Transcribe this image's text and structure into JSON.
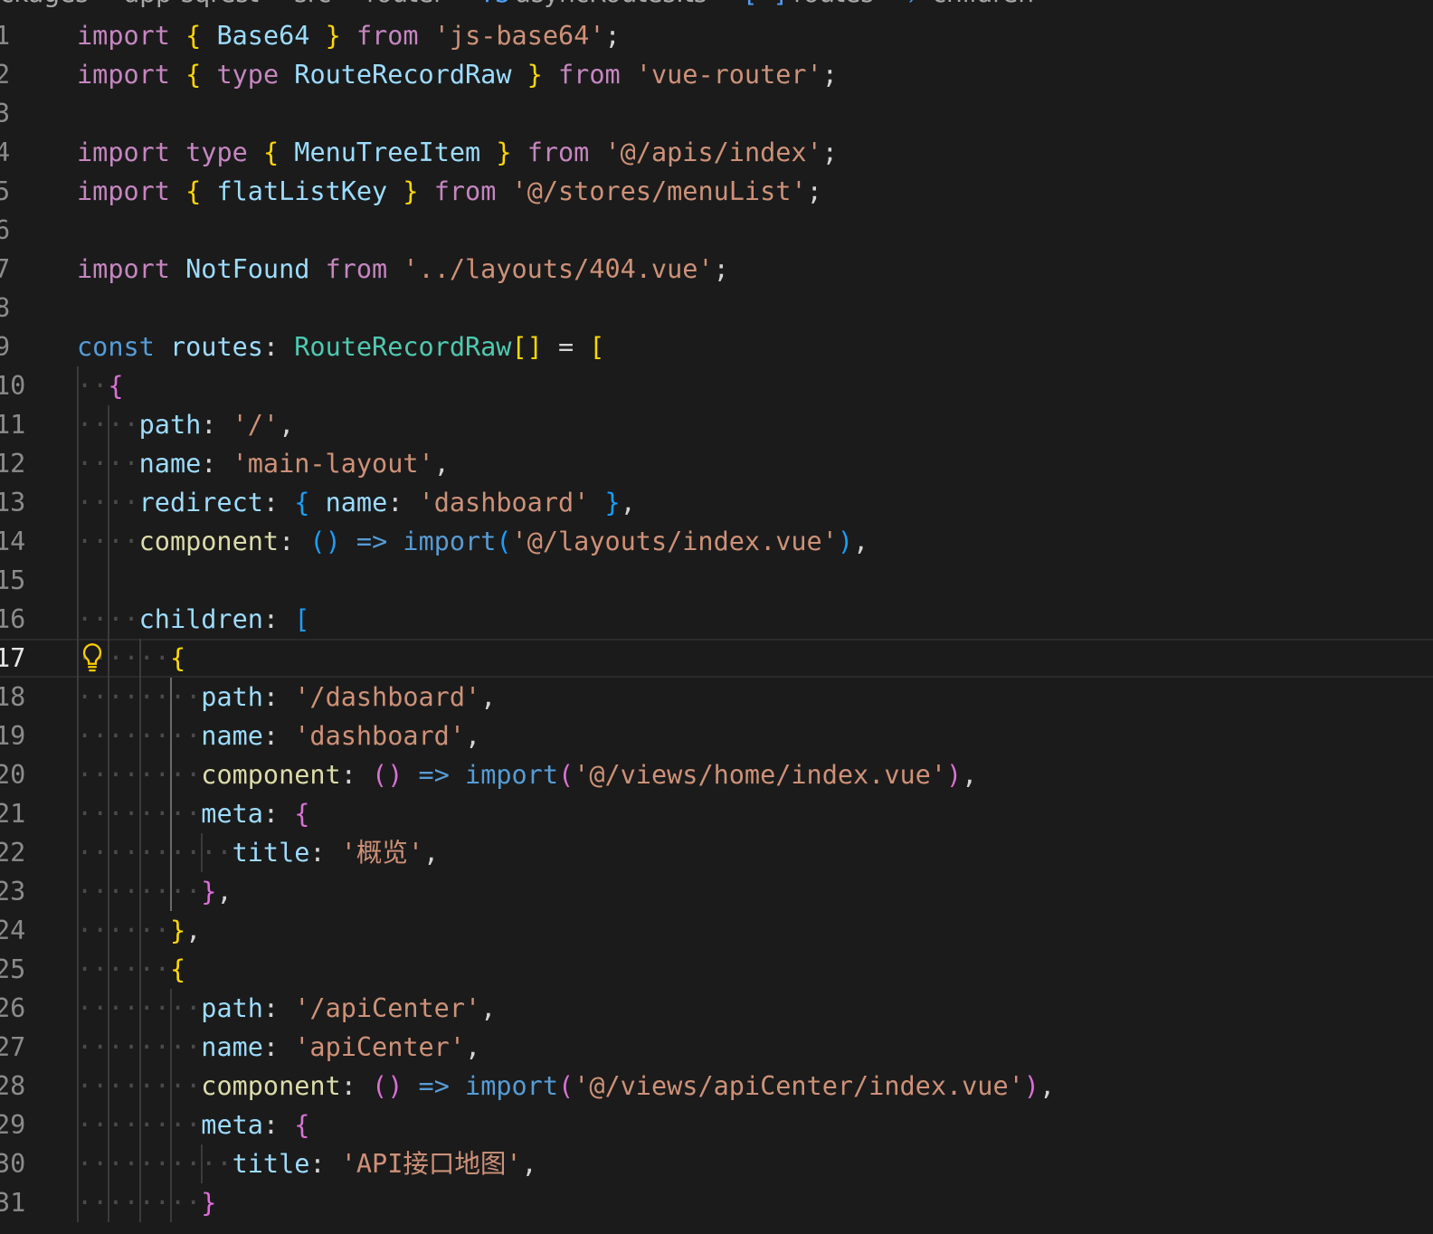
{
  "breadcrumb": {
    "items": [
      "ckages",
      "app-sqrest",
      "src",
      "router",
      "asyncRoutes.ts",
      "routes",
      "children"
    ],
    "icons": [
      "ts-file-icon",
      "array-icon",
      "property-icon"
    ]
  },
  "editor": {
    "current_line": 17,
    "lines": [
      {
        "num": "1",
        "tokens": [
          [
            "kw",
            "import"
          ],
          [
            "p",
            " "
          ],
          [
            "b1",
            "{"
          ],
          [
            "p",
            " "
          ],
          [
            "var",
            "Base64"
          ],
          [
            "p",
            " "
          ],
          [
            "b1",
            "}"
          ],
          [
            "p",
            " "
          ],
          [
            "kw",
            "from"
          ],
          [
            "p",
            " "
          ],
          [
            "str",
            "'js-base64'"
          ],
          [
            "p",
            ";"
          ]
        ]
      },
      {
        "num": "2",
        "tokens": [
          [
            "kw",
            "import"
          ],
          [
            "p",
            " "
          ],
          [
            "b1",
            "{"
          ],
          [
            "p",
            " "
          ],
          [
            "kw",
            "type"
          ],
          [
            "p",
            " "
          ],
          [
            "var",
            "RouteRecordRaw"
          ],
          [
            "p",
            " "
          ],
          [
            "b1",
            "}"
          ],
          [
            "p",
            " "
          ],
          [
            "kw",
            "from"
          ],
          [
            "p",
            " "
          ],
          [
            "str",
            "'vue-router'"
          ],
          [
            "p",
            ";"
          ]
        ]
      },
      {
        "num": "3",
        "tokens": []
      },
      {
        "num": "4",
        "tokens": [
          [
            "kw",
            "import"
          ],
          [
            "p",
            " "
          ],
          [
            "kw",
            "type"
          ],
          [
            "p",
            " "
          ],
          [
            "b1",
            "{"
          ],
          [
            "p",
            " "
          ],
          [
            "var",
            "MenuTreeItem"
          ],
          [
            "p",
            " "
          ],
          [
            "b1",
            "}"
          ],
          [
            "p",
            " "
          ],
          [
            "kw",
            "from"
          ],
          [
            "p",
            " "
          ],
          [
            "str",
            "'@/apis/index'"
          ],
          [
            "p",
            ";"
          ]
        ]
      },
      {
        "num": "5",
        "tokens": [
          [
            "kw",
            "import"
          ],
          [
            "p",
            " "
          ],
          [
            "b1",
            "{"
          ],
          [
            "p",
            " "
          ],
          [
            "var",
            "flatListKey"
          ],
          [
            "p",
            " "
          ],
          [
            "b1",
            "}"
          ],
          [
            "p",
            " "
          ],
          [
            "kw",
            "from"
          ],
          [
            "p",
            " "
          ],
          [
            "str",
            "'@/stores/menuList'"
          ],
          [
            "p",
            ";"
          ]
        ]
      },
      {
        "num": "6",
        "tokens": []
      },
      {
        "num": "7",
        "tokens": [
          [
            "kw",
            "import"
          ],
          [
            "p",
            " "
          ],
          [
            "var",
            "NotFound"
          ],
          [
            "p",
            " "
          ],
          [
            "kw",
            "from"
          ],
          [
            "p",
            " "
          ],
          [
            "str",
            "'../layouts/404.vue'"
          ],
          [
            "p",
            ";"
          ]
        ]
      },
      {
        "num": "8",
        "tokens": []
      },
      {
        "num": "9",
        "tokens": [
          [
            "decl",
            "const"
          ],
          [
            "p",
            " "
          ],
          [
            "var",
            "routes"
          ],
          [
            "p",
            ": "
          ],
          [
            "type",
            "RouteRecordRaw"
          ],
          [
            "b1",
            "[]"
          ],
          [
            "p",
            " = "
          ],
          [
            "b1",
            "["
          ]
        ]
      },
      {
        "num": "10",
        "tokens": [
          [
            "p",
            "  "
          ],
          [
            "b2",
            "{"
          ]
        ]
      },
      {
        "num": "11",
        "tokens": [
          [
            "p",
            "    "
          ],
          [
            "var",
            "path"
          ],
          [
            "p",
            ": "
          ],
          [
            "str",
            "'/'"
          ],
          [
            "p",
            ","
          ]
        ]
      },
      {
        "num": "12",
        "tokens": [
          [
            "p",
            "    "
          ],
          [
            "var",
            "name"
          ],
          [
            "p",
            ": "
          ],
          [
            "str",
            "'main-layout'"
          ],
          [
            "p",
            ","
          ]
        ]
      },
      {
        "num": "13",
        "tokens": [
          [
            "p",
            "    "
          ],
          [
            "var",
            "redirect"
          ],
          [
            "p",
            ": "
          ],
          [
            "b3",
            "{"
          ],
          [
            "p",
            " "
          ],
          [
            "var",
            "name"
          ],
          [
            "p",
            ": "
          ],
          [
            "str",
            "'dashboard'"
          ],
          [
            "p",
            " "
          ],
          [
            "b3",
            "}"
          ],
          [
            "p",
            ","
          ]
        ]
      },
      {
        "num": "14",
        "tokens": [
          [
            "p",
            "    "
          ],
          [
            "fn",
            "component"
          ],
          [
            "p",
            ": "
          ],
          [
            "b3",
            "()"
          ],
          [
            "p",
            " "
          ],
          [
            "decl",
            "=>"
          ],
          [
            "p",
            " "
          ],
          [
            "imp",
            "import"
          ],
          [
            "b3",
            "("
          ],
          [
            "str",
            "'@/layouts/index.vue'"
          ],
          [
            "b3",
            ")"
          ],
          [
            "p",
            ","
          ]
        ]
      },
      {
        "num": "15",
        "tokens": []
      },
      {
        "num": "16",
        "tokens": [
          [
            "p",
            "    "
          ],
          [
            "var",
            "children"
          ],
          [
            "p",
            ": "
          ],
          [
            "b3",
            "["
          ]
        ]
      },
      {
        "num": "17",
        "tokens": [
          [
            "p",
            "      "
          ],
          [
            "b1",
            "{"
          ]
        ]
      },
      {
        "num": "18",
        "tokens": [
          [
            "p",
            "        "
          ],
          [
            "var",
            "path"
          ],
          [
            "p",
            ": "
          ],
          [
            "str",
            "'/dashboard'"
          ],
          [
            "p",
            ","
          ]
        ]
      },
      {
        "num": "19",
        "tokens": [
          [
            "p",
            "        "
          ],
          [
            "var",
            "name"
          ],
          [
            "p",
            ": "
          ],
          [
            "str",
            "'dashboard'"
          ],
          [
            "p",
            ","
          ]
        ]
      },
      {
        "num": "20",
        "tokens": [
          [
            "p",
            "        "
          ],
          [
            "fn",
            "component"
          ],
          [
            "p",
            ": "
          ],
          [
            "b2",
            "()"
          ],
          [
            "p",
            " "
          ],
          [
            "decl",
            "=>"
          ],
          [
            "p",
            " "
          ],
          [
            "imp",
            "import"
          ],
          [
            "b2",
            "("
          ],
          [
            "str",
            "'@/views/home/index.vue'"
          ],
          [
            "b2",
            ")"
          ],
          [
            "p",
            ","
          ]
        ]
      },
      {
        "num": "21",
        "tokens": [
          [
            "p",
            "        "
          ],
          [
            "var",
            "meta"
          ],
          [
            "p",
            ": "
          ],
          [
            "b2",
            "{"
          ]
        ]
      },
      {
        "num": "22",
        "tokens": [
          [
            "p",
            "          "
          ],
          [
            "var",
            "title"
          ],
          [
            "p",
            ": "
          ],
          [
            "str",
            "'概览'"
          ],
          [
            "p",
            ","
          ]
        ]
      },
      {
        "num": "23",
        "tokens": [
          [
            "p",
            "        "
          ],
          [
            "b2",
            "}"
          ],
          [
            "p",
            ","
          ]
        ]
      },
      {
        "num": "24",
        "tokens": [
          [
            "p",
            "      "
          ],
          [
            "b1",
            "}"
          ],
          [
            "p",
            ","
          ]
        ]
      },
      {
        "num": "25",
        "tokens": [
          [
            "p",
            "      "
          ],
          [
            "b1",
            "{"
          ]
        ]
      },
      {
        "num": "26",
        "tokens": [
          [
            "p",
            "        "
          ],
          [
            "var",
            "path"
          ],
          [
            "p",
            ": "
          ],
          [
            "str",
            "'/apiCenter'"
          ],
          [
            "p",
            ","
          ]
        ]
      },
      {
        "num": "27",
        "tokens": [
          [
            "p",
            "        "
          ],
          [
            "var",
            "name"
          ],
          [
            "p",
            ": "
          ],
          [
            "str",
            "'apiCenter'"
          ],
          [
            "p",
            ","
          ]
        ]
      },
      {
        "num": "28",
        "tokens": [
          [
            "p",
            "        "
          ],
          [
            "fn",
            "component"
          ],
          [
            "p",
            ": "
          ],
          [
            "b2",
            "()"
          ],
          [
            "p",
            " "
          ],
          [
            "decl",
            "=>"
          ],
          [
            "p",
            " "
          ],
          [
            "imp",
            "import"
          ],
          [
            "b2",
            "("
          ],
          [
            "str",
            "'@/views/apiCenter/index.vue'"
          ],
          [
            "b2",
            ")"
          ],
          [
            "p",
            ","
          ]
        ]
      },
      {
        "num": "29",
        "tokens": [
          [
            "p",
            "        "
          ],
          [
            "var",
            "meta"
          ],
          [
            "p",
            ": "
          ],
          [
            "b2",
            "{"
          ]
        ]
      },
      {
        "num": "30",
        "tokens": [
          [
            "p",
            "          "
          ],
          [
            "var",
            "title"
          ],
          [
            "p",
            ": "
          ],
          [
            "str",
            "'API接口地图'"
          ],
          [
            "p",
            ","
          ]
        ]
      },
      {
        "num": "31",
        "tokens": [
          [
            "p",
            "        "
          ],
          [
            "b2",
            "}"
          ]
        ]
      }
    ]
  },
  "colors": {
    "background": "#1b1b1b",
    "keyword": "#c586c0",
    "declaration": "#569cd6",
    "variable": "#9cdcfe",
    "type": "#4ec9b0",
    "string": "#ce9178",
    "function": "#dcdcaa",
    "bracket1": "#ffd700",
    "bracket2": "#da70d6",
    "bracket3": "#179fff"
  },
  "gutter_icons": [
    {
      "line": 17,
      "icon": "lightbulb-icon"
    }
  ]
}
